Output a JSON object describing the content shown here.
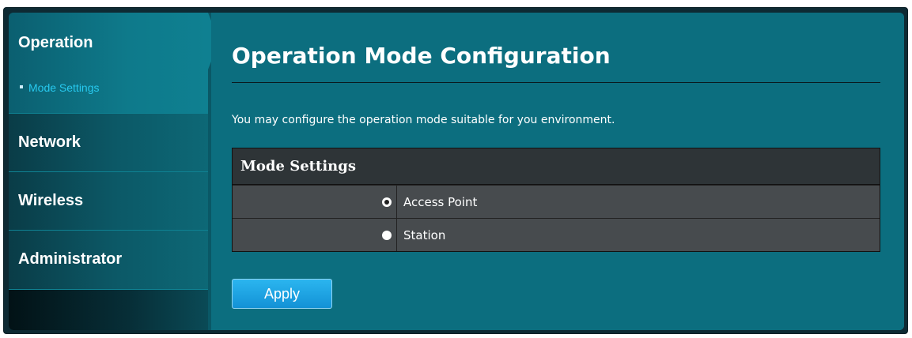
{
  "sidebar": {
    "items": [
      {
        "label": "Operation",
        "active": true,
        "subitems": [
          {
            "label": "Mode Settings"
          }
        ]
      },
      {
        "label": "Network"
      },
      {
        "label": "Wireless"
      },
      {
        "label": "Administrator"
      }
    ]
  },
  "main": {
    "title": "Operation Mode Configuration",
    "description": "You may configure the operation mode suitable for you environment.",
    "panel": {
      "header": "Mode Settings",
      "options": [
        {
          "label": "Access Point",
          "checked": true
        },
        {
          "label": "Station",
          "checked": false
        }
      ]
    },
    "apply_label": "Apply"
  },
  "colors": {
    "background": "#0c6e7f",
    "accent": "#27c9ef",
    "button": "#1392d6",
    "panel_header": "#2e3437",
    "panel_row": "#474b4e"
  },
  "icons": [
    "bullet-icon",
    "radio-checked-icon",
    "radio-unchecked-icon"
  ]
}
